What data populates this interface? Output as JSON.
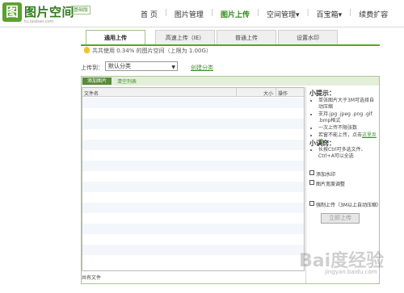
{
  "header": {
    "logo_glyph": "图",
    "logo_title": "图片空间",
    "logo_badge": "基础版",
    "logo_sub": "tu.taobao.com",
    "nav": [
      {
        "label": "首 页"
      },
      {
        "label": "图片管理"
      },
      {
        "label": "图片上传",
        "active": true
      },
      {
        "label": "空间管理▾"
      },
      {
        "label": "百宝箱▾"
      },
      {
        "label": "续费扩容"
      }
    ]
  },
  "tabs": [
    {
      "label": "通用上传",
      "active": true
    },
    {
      "label": "高速上传（IE）"
    },
    {
      "label": "普通上传"
    },
    {
      "label": "设置水印"
    }
  ],
  "info": {
    "text": "共共使用 0.34% 的图片空间（上限为 1.00G）"
  },
  "upload_to": {
    "label": "上传到：",
    "selected": "默认分类",
    "create_link": "创建分类"
  },
  "toolbar": {
    "add_button": "添加图片",
    "clear_link": "清空列表"
  },
  "list": {
    "columns": {
      "name": "文件名",
      "size": "大小",
      "op": "操作"
    },
    "count_text": "共有文件"
  },
  "tips": {
    "title": "小提示：",
    "items": [
      "单张图片大于3M可选择自动压缩",
      "支持.jpg .jpeg .png .gif .bmp格式",
      "一次上传不限张数",
      "若窗不能上传，点击"
    ],
    "link": "这里反馈"
  },
  "tips2": {
    "title": "小诀窍：",
    "items": [
      "长按Ctrl可多选文件、Ctrl+A可以全选"
    ]
  },
  "options": {
    "watermark": "添加水印",
    "resize": "图片宽度调整",
    "compress": "强制上传（3M以上自动压缩）"
  },
  "submit": {
    "label": "立即上传"
  },
  "watermark": {
    "text": "Bai度经验",
    "url": "jingyan.baidu.com"
  }
}
